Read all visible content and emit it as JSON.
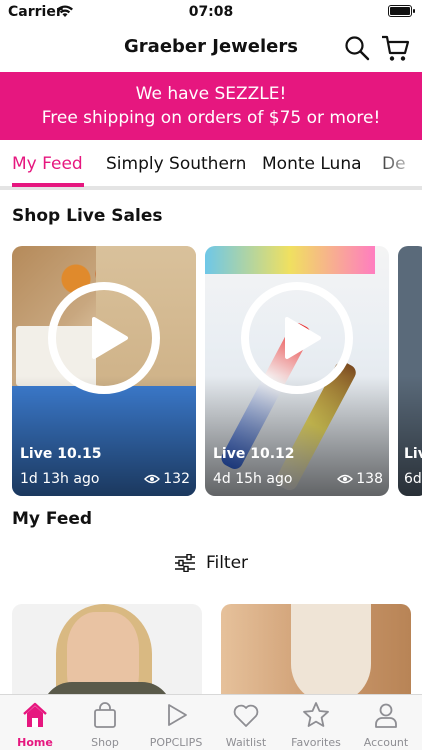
{
  "status": {
    "carrier": "Carrier",
    "time": "07:08"
  },
  "header": {
    "title": "Graeber Jewelers"
  },
  "promo": {
    "line1": "We have SEZZLE!",
    "line2": "Free shipping on orders of $75 or more!"
  },
  "tabs": [
    {
      "label": "My Feed",
      "active": true
    },
    {
      "label": "Simply Southern"
    },
    {
      "label": "Monte Luna"
    },
    {
      "label": "De"
    }
  ],
  "sections": {
    "live_sales": "Shop Live Sales",
    "my_feed": "My Feed"
  },
  "live_sales": [
    {
      "label": "Live 10.15",
      "ago": "1d 13h ago",
      "views": "132"
    },
    {
      "label": "Live 10.12",
      "ago": "4d 15h ago",
      "views": "138"
    },
    {
      "label": "Liv",
      "ago": "6d"
    }
  ],
  "filter": {
    "label": "Filter"
  },
  "colors": {
    "accent": "#e6177f",
    "inactive": "#8e8e93"
  },
  "tabbar": [
    {
      "label": "Home",
      "icon": "home-icon",
      "active": true
    },
    {
      "label": "Shop",
      "icon": "bag-icon"
    },
    {
      "label": "POPCLIPS",
      "icon": "play-icon"
    },
    {
      "label": "Waitlist",
      "icon": "heart-icon"
    },
    {
      "label": "Favorites",
      "icon": "star-icon"
    },
    {
      "label": "Account",
      "icon": "person-icon"
    }
  ]
}
